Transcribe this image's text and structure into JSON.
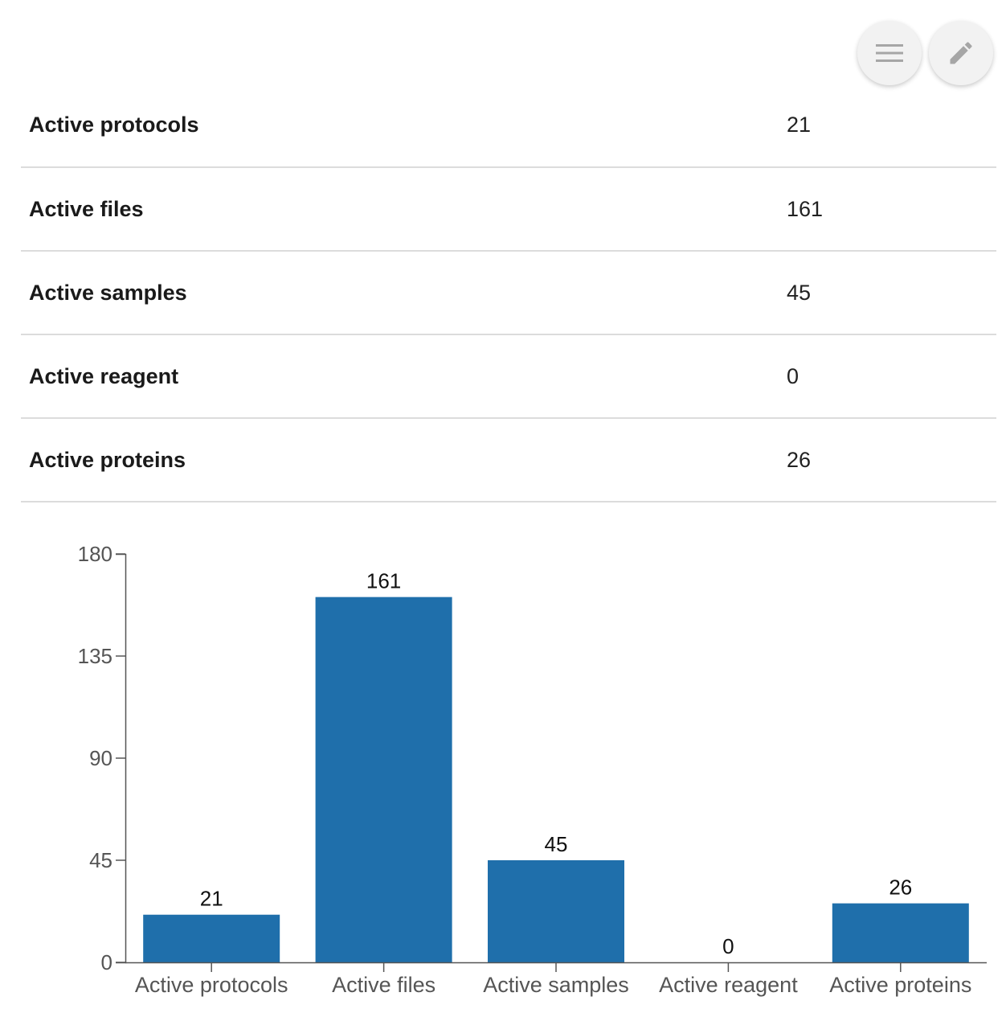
{
  "toolbar": {
    "menu_icon": "hamburger-menu-icon",
    "edit_icon": "pencil-icon",
    "button_bg": "#f2f2f2",
    "icon_color": "#a6a6a6"
  },
  "stats": [
    {
      "label": "Active protocols",
      "value": "21"
    },
    {
      "label": "Active files",
      "value": "161"
    },
    {
      "label": "Active samples",
      "value": "45"
    },
    {
      "label": "Active reagent",
      "value": "0"
    },
    {
      "label": "Active proteins",
      "value": "26"
    }
  ],
  "chart_data": {
    "type": "bar",
    "categories": [
      "Active protocols",
      "Active files",
      "Active samples",
      "Active reagent",
      "Active proteins"
    ],
    "values": [
      21,
      161,
      45,
      0,
      26
    ],
    "data_labels": [
      "21",
      "161",
      "45",
      "0",
      "26"
    ],
    "y_ticks": [
      0,
      45,
      90,
      135,
      180
    ],
    "ylim": [
      0,
      180
    ],
    "grid": false,
    "legend": "none",
    "bar_color": "#1f6fab"
  }
}
